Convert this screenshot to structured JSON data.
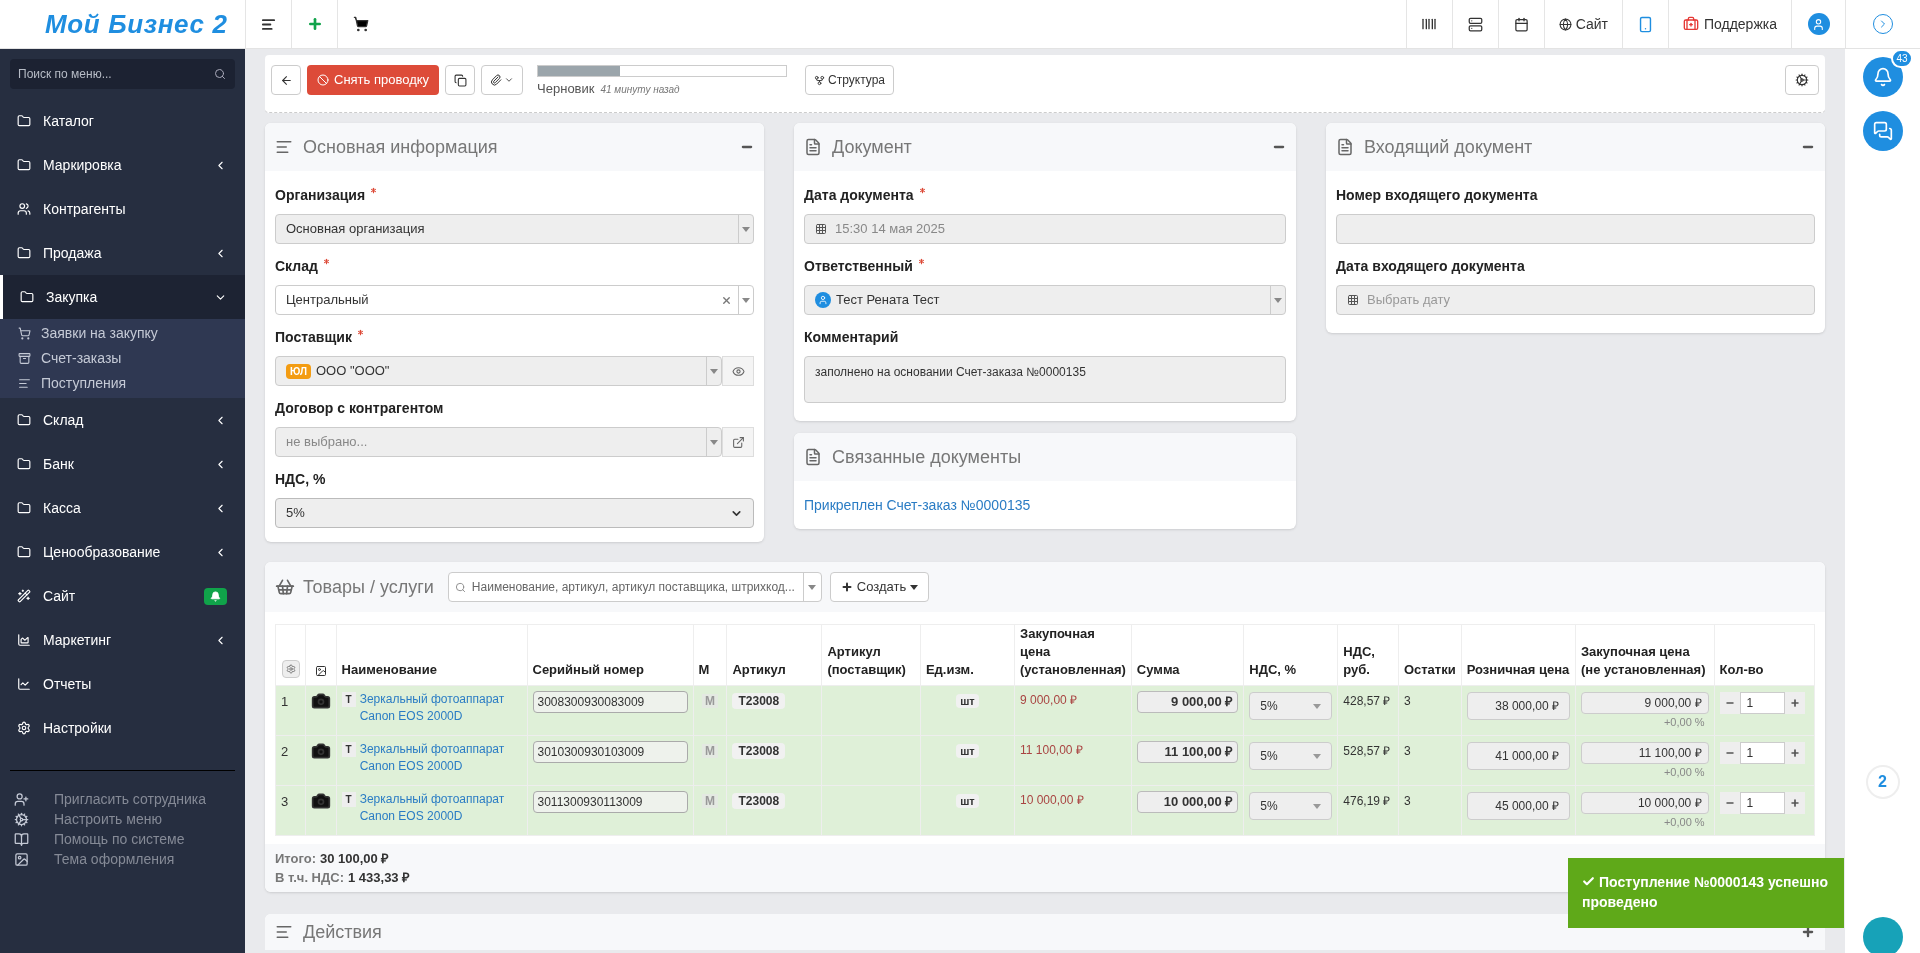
{
  "header": {
    "logo": "Мой Бизнес 2",
    "site_link": "Сайт",
    "support_link": "Поддержка"
  },
  "sidebar": {
    "search_placeholder": "Поиск по меню...",
    "items": [
      {
        "label": "Каталог",
        "selected": false
      },
      {
        "label": "Маркировка",
        "selected": false,
        "expanded": false
      },
      {
        "label": "Контрагенты",
        "selected": false
      },
      {
        "label": "Продажа",
        "selected": false,
        "expanded": false
      },
      {
        "label": "Закупка",
        "selected": true,
        "expanded": true,
        "children": [
          {
            "label": "Заявки на закупку"
          },
          {
            "label": "Счет-заказы"
          },
          {
            "label": "Поступления"
          }
        ]
      },
      {
        "label": "Склад",
        "selected": false,
        "expanded": false
      },
      {
        "label": "Банк",
        "selected": false,
        "expanded": false
      },
      {
        "label": "Касса",
        "selected": false,
        "expanded": false
      },
      {
        "label": "Ценообразование",
        "selected": false,
        "expanded": false
      },
      {
        "label": "Сайт",
        "selected": false,
        "badge": true
      },
      {
        "label": "Маркетинг",
        "selected": false,
        "expanded": false
      },
      {
        "label": "Отчеты",
        "selected": false
      },
      {
        "label": "Настройки",
        "selected": false
      }
    ],
    "footer_links": [
      "Пригласить сотрудника",
      "Настроить меню",
      "Помощь по системе",
      "Тема оформления"
    ]
  },
  "toolbar": {
    "unpost_button": "Снять проводку",
    "progress": {
      "level": 0.33
    },
    "status": "Черновик",
    "status_time": "41 минуту назад",
    "structure_button": "Структура"
  },
  "main_info": {
    "title": "Основная информация",
    "fields": [
      {
        "label": "Организация",
        "required": true,
        "value": "Основная организация",
        "disabled": true,
        "clearable": false,
        "view_button": false,
        "link_button": false
      },
      {
        "label": "Склад",
        "required": true,
        "value": "Центральный",
        "disabled": false,
        "clearable": true,
        "view_button": false,
        "link_button": false
      },
      {
        "label": "Поставщик",
        "required": true,
        "tag": "ЮЛ",
        "value": "ООО \"ООО\"",
        "disabled": true,
        "clearable": false,
        "view_button": true,
        "link_button": false
      },
      {
        "label": "Договор с контрагентом",
        "required": false,
        "placeholder": "не выбрано...",
        "disabled": true,
        "clearable": false,
        "view_button": false,
        "link_button": true
      }
    ],
    "vat": {
      "label": "НДС, %",
      "value": "5%"
    }
  },
  "document": {
    "title": "Документ",
    "date_label": "Дата документа",
    "date_required": true,
    "date_value": "15:30 14 мая 2025",
    "responsible_label": "Ответственный",
    "responsible_required": true,
    "responsible_value": "Тест Рената Тест",
    "comment_label": "Комментарий",
    "comment_value": "заполнено на основании Счет-заказа №0000135"
  },
  "related": {
    "title": "Связанные документы",
    "link": "Прикреплен Счет-заказ №0000135"
  },
  "incoming": {
    "title": "Входящий документ",
    "number_label": "Номер входящего документа",
    "date_label": "Дата входящего документа",
    "date_placeholder": "Выбрать дату"
  },
  "products": {
    "title": "Товары / услуги",
    "search_placeholder": "Наименование, артикул, артикул поставщика, штрихкод...",
    "create_button": "Создать",
    "columns": [
      "Наименование",
      "Серийный номер",
      "М",
      "Артикул",
      "Артикул (поставщик)",
      "Ед.изм.",
      "Закупочная цена (установленная)",
      "Сумма",
      "НДС, %",
      "НДС, руб.",
      "Остатки",
      "Розничная цена",
      "Закупочная цена (не установленная)",
      "Кол-во"
    ],
    "rows": [
      {
        "n": "1",
        "type": "Т",
        "name": "Зеркальный фотоаппарат Canon EOS 2000D",
        "serial": "3008300930083009",
        "m": "М",
        "article": "T23008",
        "unit": "шт",
        "purchase_price": "9 000,00 ₽",
        "sum": "9 000,00 ₽",
        "vat": "5%",
        "vat_rub": "428,57 ₽",
        "stock": "3",
        "retail": "38 000,00 ₽",
        "purchase_unset": "9 000,00 ₽",
        "markup": "+0,00 %",
        "qty": "1"
      },
      {
        "n": "2",
        "type": "Т",
        "name": "Зеркальный фотоаппарат Canon EOS 2000D",
        "serial": "3010300930103009",
        "m": "М",
        "article": "T23008",
        "unit": "шт",
        "purchase_price": "11 100,00 ₽",
        "sum": "11 100,00 ₽",
        "vat": "5%",
        "vat_rub": "528,57 ₽",
        "stock": "3",
        "retail": "41 000,00 ₽",
        "purchase_unset": "11 100,00 ₽",
        "markup": "+0,00 %",
        "qty": "1"
      },
      {
        "n": "3",
        "type": "Т",
        "name": "Зеркальный фотоаппарат Canon EOS 2000D",
        "serial": "3011300930113009",
        "m": "М",
        "article": "T23008",
        "unit": "шт",
        "purchase_price": "10 000,00 ₽",
        "sum": "10 000,00 ₽",
        "vat": "5%",
        "vat_rub": "476,19 ₽",
        "stock": "3",
        "retail": "45 000,00 ₽",
        "purchase_unset": "10 000,00 ₽",
        "markup": "+0,00 %",
        "qty": "1"
      }
    ],
    "total_label": "Итого:",
    "total": "30 100,00 ₽",
    "vat_label": "В т.ч. НДС:",
    "vat_total": "1 433,33 ₽"
  },
  "actions": {
    "title": "Действия"
  },
  "right_bar": {
    "notifications": "43",
    "count": "2"
  },
  "toast": {
    "text": "Поступление №0000143 успешно проведено"
  }
}
